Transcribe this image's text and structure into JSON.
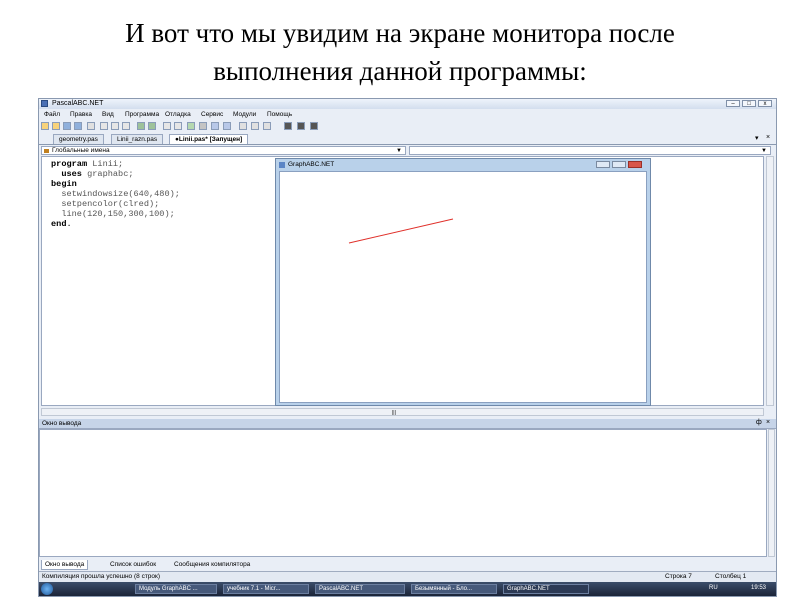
{
  "slide": {
    "title_line1": "И вот что мы увидим на экране монитора после",
    "title_line2": "выполнения данной программы:"
  },
  "ide": {
    "window_title": "PascalABC.NET",
    "menu": [
      "Файл",
      "Правка",
      "Вид",
      "Программа",
      "Отладка",
      "Сервис",
      "Модули",
      "Помощь"
    ],
    "tabs": [
      {
        "label": "geometry.pas",
        "active": false
      },
      {
        "label": "Linii_razn.pas",
        "active": false
      },
      {
        "label": "●Linii.pas* [Запущен]",
        "active": true
      }
    ],
    "scope_combo": "Глобальные имена",
    "code": {
      "line1_kw": "program",
      "line1_rest": " Linii;",
      "line2_kw": "  uses",
      "line2_rest": " graphabc;",
      "line3_kw": "begin",
      "line4": "  setwindowsize(640,480);",
      "line5": "  setpencolor(clred);",
      "line6": "  line(120,150,300,100);",
      "line7_kw": "end",
      "line7_rest": "."
    },
    "graph_window": {
      "title": "GraphABC.NET",
      "line_color": "#e0302a"
    },
    "output": {
      "title": "Окно вывода",
      "pin": "ф"
    },
    "bottom_tabs": [
      "Окно вывода",
      "Список ошибок",
      "Сообщения компилятора"
    ],
    "status": {
      "message": "Компиляция прошла успешно (8 строк)",
      "row": "Строка 7",
      "col": "Столбец 1"
    }
  },
  "taskbar": {
    "items": [
      {
        "label": "Модуль GraphABC ..."
      },
      {
        "label": "учебник 7.1 - Micr..."
      },
      {
        "label": "PascalABC.NET"
      },
      {
        "label": "Безымянный - Бло..."
      },
      {
        "label": "GraphABC.NET"
      }
    ],
    "lang": "RU",
    "clock": "19:53"
  }
}
